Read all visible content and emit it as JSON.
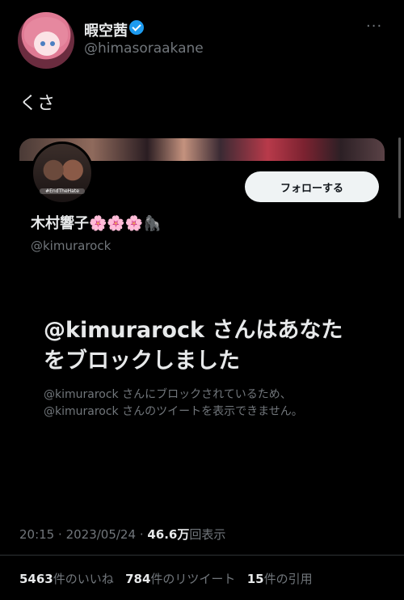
{
  "author": {
    "display_name": "暇空茜",
    "handle": "@himasoraakane"
  },
  "more_label": "···",
  "tweet_text": "くさ",
  "card": {
    "avatar_caption": "#EndTheHate",
    "follow_label": "フォローする",
    "display_name": "木村響子🌸🌸🌸🦍",
    "handle": "@kimurarock",
    "block_title": "@kimurarock さんはあなたをブロックしました",
    "block_desc_line1": "@kimurarock さんにブロックされているため、",
    "block_desc_line2": "@kimurarock さんのツイートを表示できません。"
  },
  "meta": {
    "time": "20:15",
    "date": "2023/05/24",
    "views_count": "46.6万",
    "views_label": "回表示"
  },
  "stats": {
    "likes_count": "5463",
    "likes_label": "件のいいね",
    "retweets_count": "784",
    "retweets_label": "件のリツイート",
    "quotes_count": "15",
    "quotes_label": "件の引用"
  },
  "colors": {
    "background": "#000000",
    "text_primary": "#e7e9ea",
    "text_secondary": "#71767b",
    "verified": "#1d9bf0"
  }
}
